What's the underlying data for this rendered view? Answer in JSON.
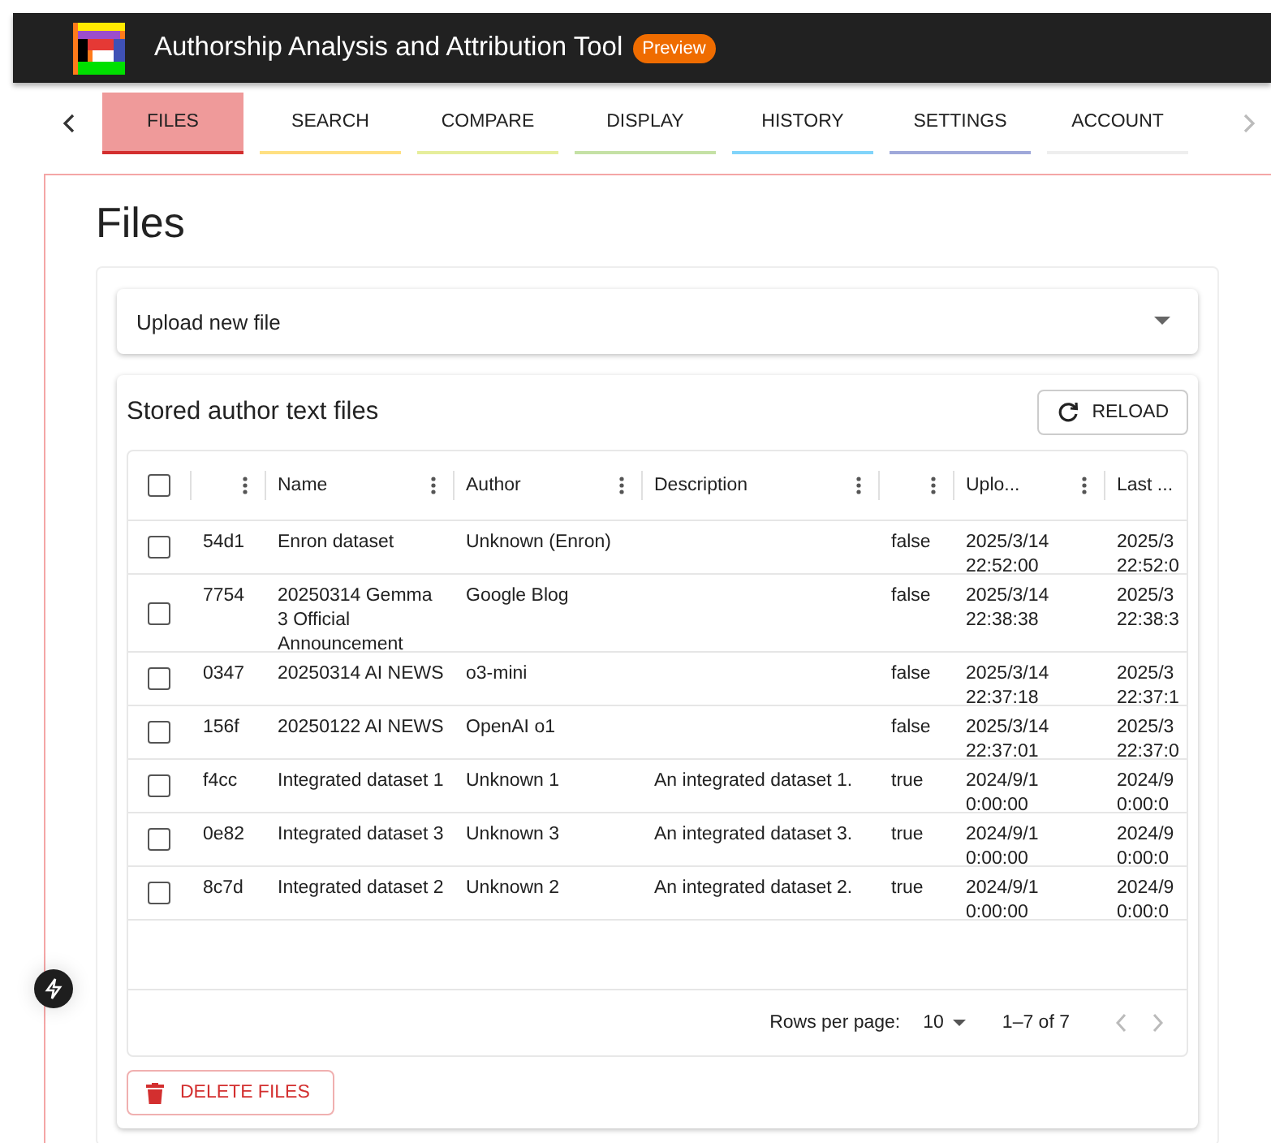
{
  "app": {
    "title": "Authorship Analysis and Attribution Tool",
    "badge": "Preview"
  },
  "tabs": [
    {
      "label": "FILES",
      "selected": true,
      "color": "#ef9a9a"
    },
    {
      "label": "SEARCH",
      "selected": false,
      "color": "#ffe082"
    },
    {
      "label": "COMPARE",
      "selected": false,
      "color": "#e6ee9c"
    },
    {
      "label": "DISPLAY",
      "selected": false,
      "color": "#c5e1a5"
    },
    {
      "label": "HISTORY",
      "selected": false,
      "color": "#81d4fa"
    },
    {
      "label": "SETTINGS",
      "selected": false,
      "color": "#9fa8da"
    },
    {
      "label": "ACCOUNT",
      "selected": false,
      "color": "#eeeeee"
    }
  ],
  "page_title": "Files",
  "upload": {
    "label": "Upload new file",
    "expanded": false
  },
  "stored": {
    "title": "Stored author text files",
    "reload": "RELOAD"
  },
  "table": {
    "select_all": {
      "checked": false
    },
    "columns": [
      "",
      "Name",
      "Author",
      "Description",
      "",
      "Uplo...",
      "Last ..."
    ],
    "rows": [
      {
        "checked": false,
        "cells": [
          "54d1",
          "Enron dataset",
          "Unknown (Enron)",
          "",
          "false",
          "2025/3/14 22:52:00",
          "2025/3 22:52:0"
        ]
      },
      {
        "checked": false,
        "cells": [
          "7754",
          "20250314 Gemma 3 Official Announcement",
          "Google Blog",
          "",
          "false",
          "2025/3/14 22:38:38",
          "2025/3 22:38:3"
        ]
      },
      {
        "checked": false,
        "cells": [
          "0347",
          "20250314 AI NEWS",
          "o3-mini",
          "",
          "false",
          "2025/3/14 22:37:18",
          "2025/3 22:37:1"
        ]
      },
      {
        "checked": false,
        "cells": [
          "156f",
          "20250122 AI NEWS",
          "OpenAI o1",
          "",
          "false",
          "2025/3/14 22:37:01",
          "2025/3 22:37:0"
        ]
      },
      {
        "checked": false,
        "cells": [
          "f4cc",
          "Integrated dataset 1",
          "Unknown 1",
          "An integrated dataset 1.",
          "true",
          "2024/9/1 0:00:00",
          "2024/9 0:00:0"
        ]
      },
      {
        "checked": false,
        "cells": [
          "0e82",
          "Integrated dataset 3",
          "Unknown 3",
          "An integrated dataset 3.",
          "true",
          "2024/9/1 0:00:00",
          "2024/9 0:00:0"
        ]
      },
      {
        "checked": false,
        "cells": [
          "8c7d",
          "Integrated dataset 2",
          "Unknown 2",
          "An integrated dataset 2.",
          "true",
          "2024/9/1 0:00:00",
          "2024/9 0:00:0"
        ]
      }
    ],
    "footer": {
      "rows_per_page_label": "Rows per page:",
      "rows_per_page": "10",
      "range": "1–7 of 7"
    }
  },
  "delete_button": "DELETE FILES"
}
